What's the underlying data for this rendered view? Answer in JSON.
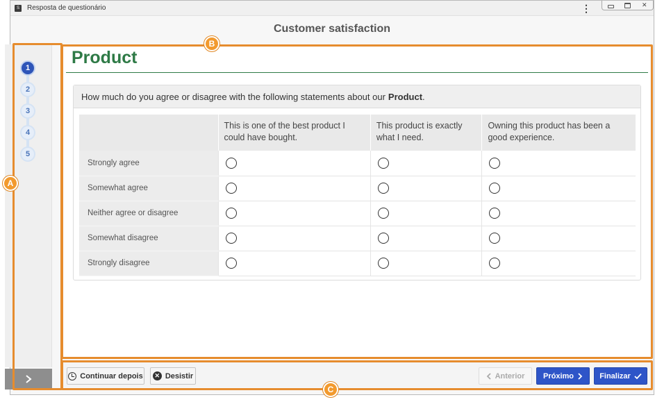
{
  "window": {
    "title": "Resposta de questionário",
    "app_icon_glyph": "S",
    "kebab_glyph": "⋮",
    "close_glyph": "✕"
  },
  "header": {
    "title": "Customer satisfaction"
  },
  "sidebar": {
    "steps": [
      "1",
      "2",
      "3",
      "4",
      "5"
    ],
    "active_step": "1",
    "toggle_icon": "chevron-right-icon"
  },
  "section": {
    "title": "Product"
  },
  "question": {
    "prompt": "How much do you agree or disagree with the following statements about our",
    "prompt_bold": "Product",
    "prompt_end": ".",
    "columns": [
      "This is one of the best product I could have bought.",
      "This product is exactly what I need.",
      "Owning this product has been a good experience."
    ],
    "rows": [
      "Strongly agree",
      "Somewhat agree",
      "Neither agree or disagree",
      "Somewhat disagree",
      "Strongly disagree"
    ]
  },
  "footer": {
    "continue_later": "Continuar depois",
    "give_up": "Desistir",
    "previous": "Anterior",
    "next": "Próximo",
    "finish": "Finalizar"
  },
  "annotations": {
    "a": "A",
    "b": "B",
    "c": "C"
  },
  "colors": {
    "accent_primary": "#2e55c8",
    "section_title": "#2e7a46",
    "annotation": "#e68c2e"
  }
}
